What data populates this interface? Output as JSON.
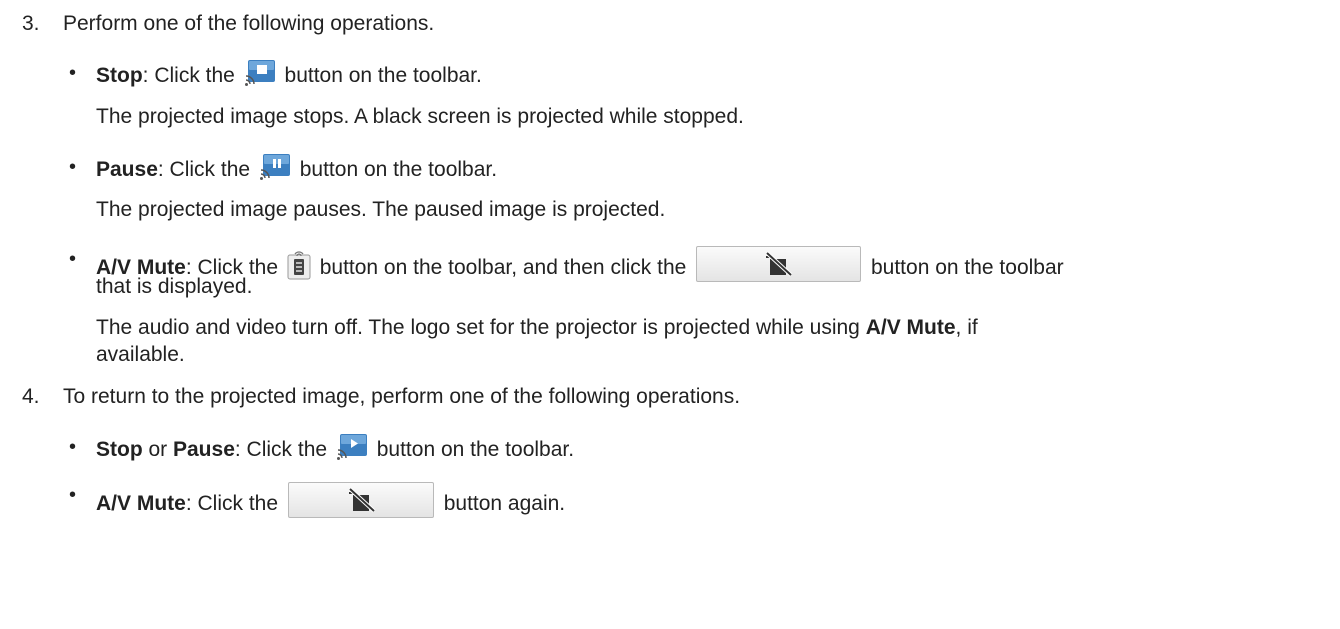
{
  "steps": [
    {
      "number": "3.",
      "text": "Perform one of the following operations."
    },
    {
      "number": "4.",
      "text": "To return to the projected image, perform one of the following operations."
    }
  ],
  "items": {
    "stop": {
      "label": "Stop",
      "pre": ": Click the ",
      "post": " button on the toolbar.",
      "note": "The projected image stops. A black screen is projected while stopped.",
      "icon": "stop-projection-icon"
    },
    "pause": {
      "label": "Pause",
      "pre": ": Click the ",
      "post": " button on the toolbar.",
      "note": "The projected image pauses. The paused image is projected.",
      "icon": "pause-projection-icon"
    },
    "avmute": {
      "label": "A/V Mute",
      "pre": ": Click the ",
      "mid": " button on the toolbar, and then click the ",
      "post": " button on the toolbar",
      "cont": "that is displayed.",
      "note1": "The audio and video turn off. The logo set for the projector is projected while using ",
      "note_bold": "A/V Mute",
      "note2": ", if",
      "note3": "available.",
      "icon": "remote-control-icon",
      "button_icon": "av-mute-icon"
    },
    "resume": {
      "label1": "Stop",
      "or": " or ",
      "label2": "Pause",
      "pre": ": Click the ",
      "post": " button on the toolbar.",
      "icon": "start-projection-icon"
    },
    "unmute": {
      "label": "A/V Mute",
      "pre": ": Click the ",
      "post": " button again.",
      "button_icon": "av-mute-icon"
    }
  },
  "colors": {
    "text": "#222222",
    "icon_blue": "#3c7fc0"
  }
}
